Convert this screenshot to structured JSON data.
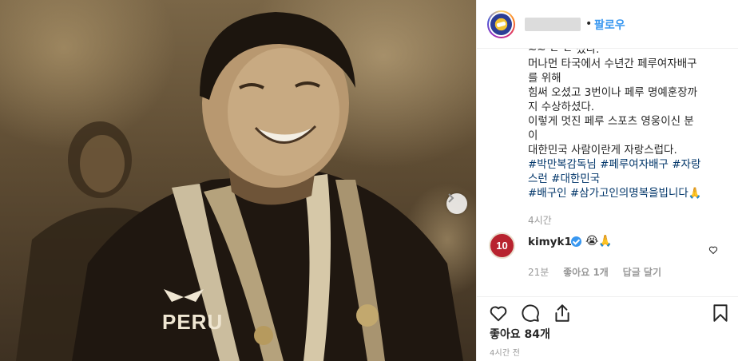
{
  "photo": {
    "jersey_text": "PERU"
  },
  "header": {
    "separator": "•",
    "follow_label": "팔로우"
  },
  "caption": {
    "lines": [
      "~~ ㄷ ㄷ 셨다.",
      "머나먼 타국에서 수년간 페루여자배구",
      "를 위해",
      "힘써 오셨고 3번이나 페루 명예훈장까",
      "지 수상하셨다.",
      "이렇게 멋진 페루 스포츠 영웅이신 분",
      "이",
      "대한민국 사람이란게 자랑스럽다."
    ],
    "hashtag_lines": [
      "#박만복감독님 #페루여자배구 #자랑",
      "스런 #대한민국",
      "#배구인 #삼가고인의명복을빕니다🙏"
    ],
    "time": "4시간"
  },
  "comment": {
    "avatar_text": "10",
    "username": "kimyk10",
    "emoji": "😭🙏",
    "time": "21분",
    "likes": "좋아요 1개",
    "reply": "답글 달기"
  },
  "footer": {
    "likes": "좋아요 84개",
    "post_time": "4시간 전"
  },
  "icons": {
    "like": "heart-icon",
    "comment": "comment-icon",
    "share": "share-icon",
    "save": "bookmark-icon",
    "next": "chevron-right-icon"
  },
  "colors": {
    "link": "#3897f0",
    "hashtag": "#003569",
    "muted": "#999999"
  }
}
